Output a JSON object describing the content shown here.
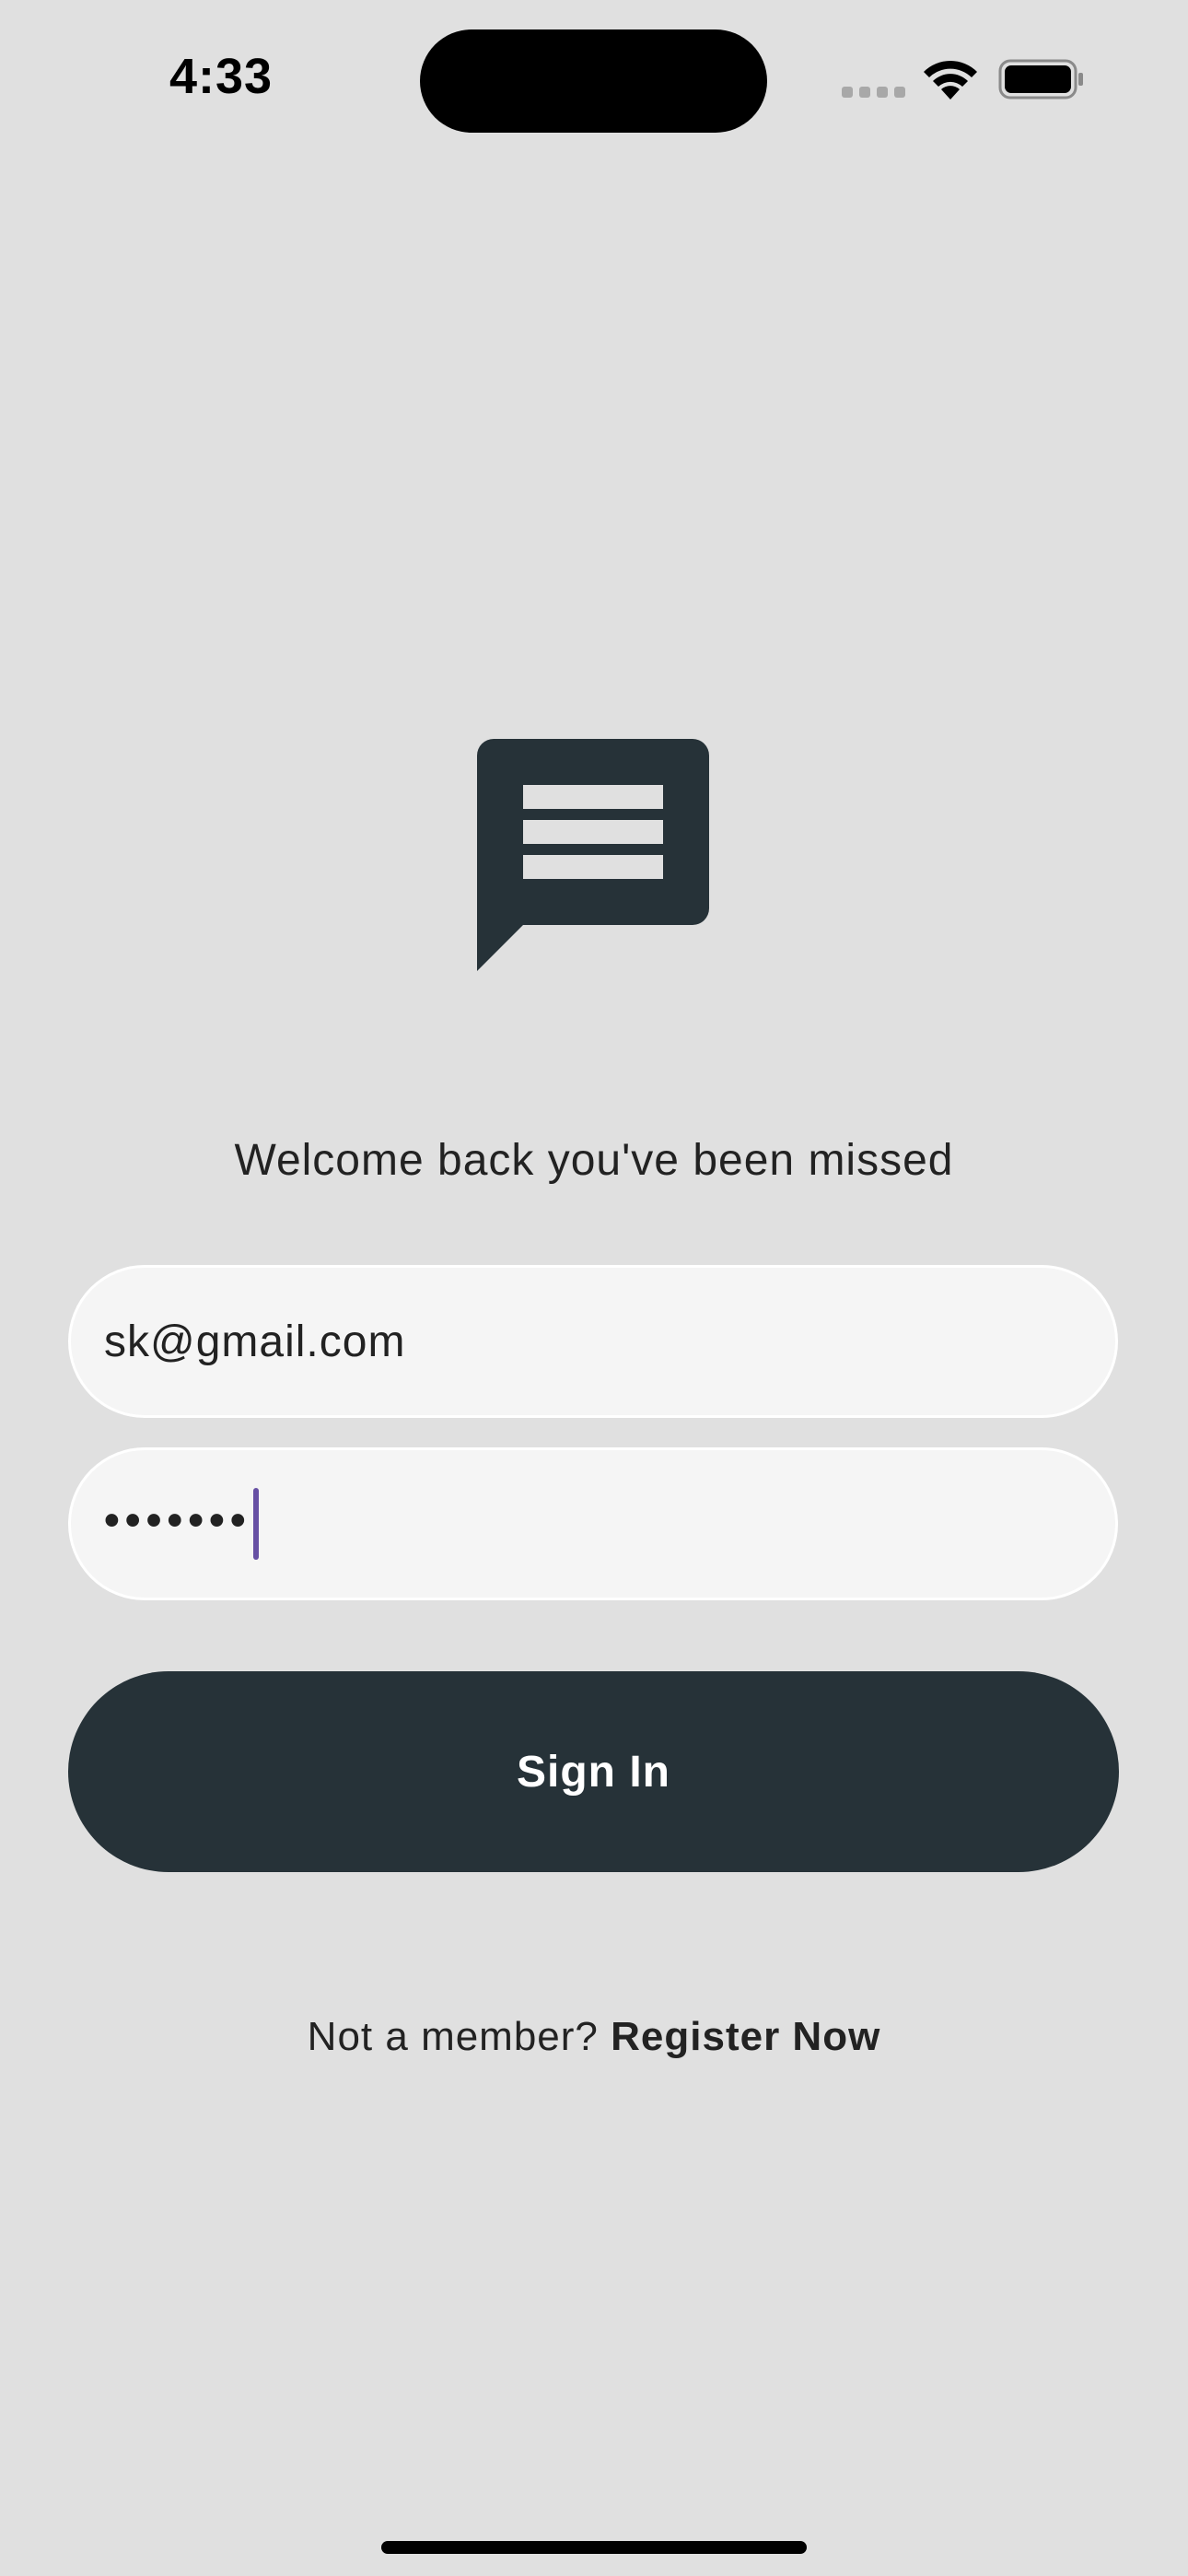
{
  "status_bar": {
    "time": "4:33"
  },
  "welcome": {
    "message": "Welcome back you've been missed"
  },
  "form": {
    "email_value": "sk@gmail.com",
    "password_value": "•••••••"
  },
  "actions": {
    "sign_in_label": "Sign In",
    "register_prompt": "Not a member?",
    "register_link": "Register Now"
  },
  "colors": {
    "background": "#e0e0e0",
    "primary": "#263238",
    "field": "#f5f5f5",
    "cursor": "#6750a4"
  },
  "icons": {
    "logo": "chat-bubble-icon",
    "wifi": "wifi-icon",
    "battery": "battery-icon",
    "cellular": "cellular-signal-icon"
  }
}
